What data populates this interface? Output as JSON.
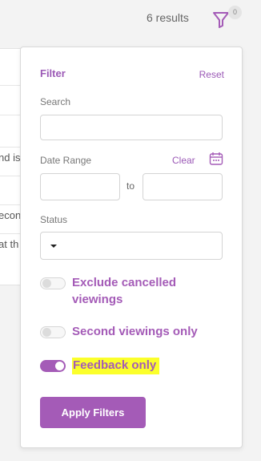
{
  "header": {
    "results_count": "6 results",
    "filter_badge": "0"
  },
  "background_list": {
    "rows": [
      "",
      "",
      "nd is",
      "",
      "econ",
      "at th"
    ]
  },
  "filter_panel": {
    "title": "Filter",
    "reset_label": "Reset",
    "search": {
      "label": "Search",
      "value": "",
      "placeholder": ""
    },
    "date_range": {
      "label": "Date Range",
      "clear_label": "Clear",
      "from_value": "",
      "to_label": "to",
      "to_value": ""
    },
    "status": {
      "label": "Status",
      "selected": ""
    },
    "toggles": [
      {
        "label_line1": "Exclude cancelled",
        "label_line2": "viewings",
        "checked": false
      },
      {
        "label": "Second viewings only",
        "checked": false
      },
      {
        "label": "Feedback only",
        "checked": true,
        "highlighted": true
      }
    ],
    "apply_label": "Apply Filters"
  },
  "colors": {
    "accent": "#a45bb7",
    "highlight": "#fbff2b",
    "background": "#f3f3f3"
  },
  "icons": {
    "filter": "funnel-icon",
    "calendar": "calendar-icon"
  }
}
